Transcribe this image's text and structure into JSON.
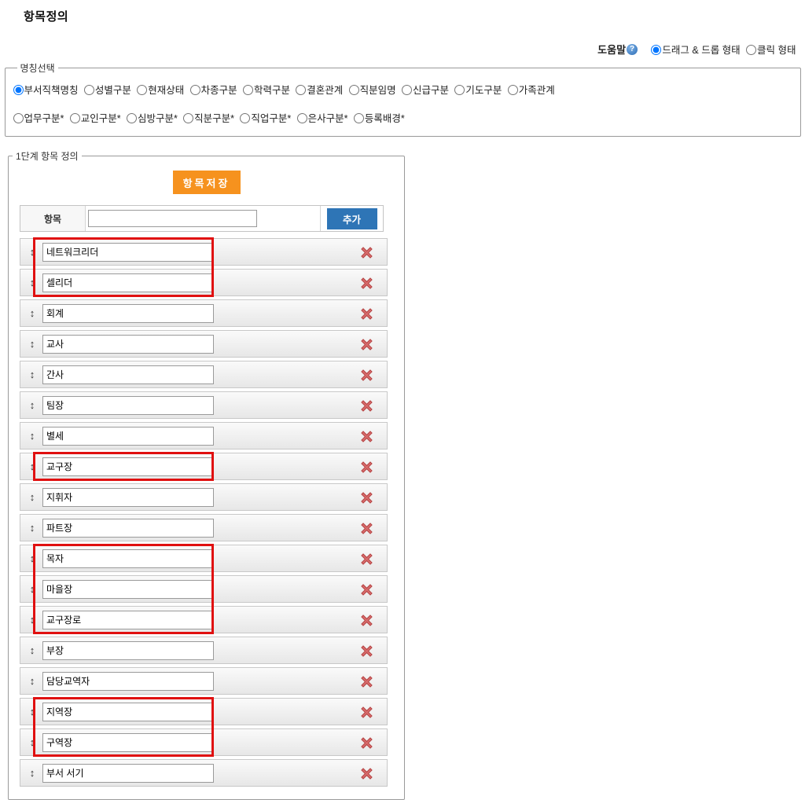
{
  "page": {
    "title": "항목정의"
  },
  "help": {
    "label": "도움말",
    "icon": "question-icon",
    "icon_glyph": "?"
  },
  "view_mode": {
    "options": [
      {
        "label": "드래그 & 드롭 형태",
        "checked": true
      },
      {
        "label": "클릭 형태",
        "checked": false
      }
    ]
  },
  "name_select": {
    "legend": "명칭선택",
    "row1": [
      {
        "label": "부서직책명칭",
        "checked": true
      },
      {
        "label": "성별구분",
        "checked": false
      },
      {
        "label": "현재상태",
        "checked": false
      },
      {
        "label": "차종구분",
        "checked": false
      },
      {
        "label": "학력구분",
        "checked": false
      },
      {
        "label": "결혼관계",
        "checked": false
      },
      {
        "label": "직분임명",
        "checked": false
      },
      {
        "label": "신급구분",
        "checked": false
      },
      {
        "label": "기도구분",
        "checked": false
      },
      {
        "label": "가족관계",
        "checked": false
      }
    ],
    "row2": [
      {
        "label": "업무구분*",
        "checked": false
      },
      {
        "label": "교인구분*",
        "checked": false
      },
      {
        "label": "심방구분*",
        "checked": false
      },
      {
        "label": "직분구분*",
        "checked": false
      },
      {
        "label": "직업구분*",
        "checked": false
      },
      {
        "label": "은사구분*",
        "checked": false
      },
      {
        "label": "등록배경*",
        "checked": false
      }
    ]
  },
  "step1": {
    "legend": "1단계 항목 정의",
    "save_button": "항목저장",
    "add_row": {
      "label": "항목",
      "input_value": "",
      "add_button": "추가"
    },
    "items": [
      "네트워크리더",
      "셀리더",
      "회계",
      "교사",
      "간사",
      "팀장",
      "별세",
      "교구장",
      "지휘자",
      "파트장",
      "목자",
      "마을장",
      "교구장로",
      "부장",
      "담당교역자",
      "지역장",
      "구역장",
      "부서 서기"
    ],
    "highlight_groups": [
      {
        "start": 0,
        "end": 1
      },
      {
        "start": 7,
        "end": 7
      },
      {
        "start": 10,
        "end": 12
      },
      {
        "start": 15,
        "end": 16
      }
    ]
  },
  "colors": {
    "save_orange": "#F6921E",
    "add_blue": "#2E75B6",
    "highlight_red": "#E01010",
    "delete_red": "#CC4A4A"
  }
}
